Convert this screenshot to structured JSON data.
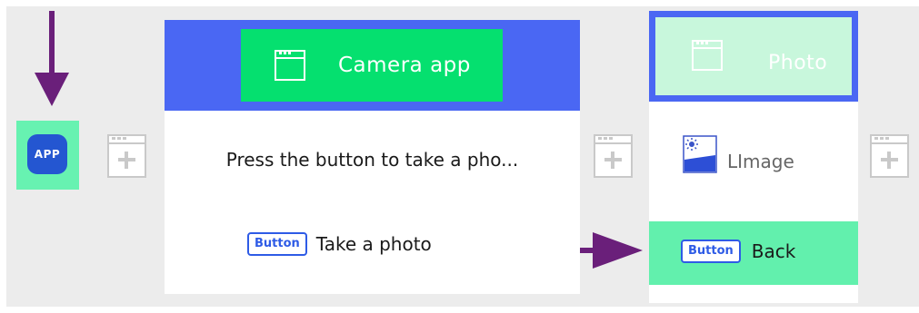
{
  "app_icon": {
    "label": "APP"
  },
  "screen1": {
    "title": "Camera app",
    "text": "Press the button to take a pho...",
    "button": {
      "chip": "Button",
      "label": "Take a photo"
    }
  },
  "screen2": {
    "title": "Photo",
    "image": {
      "label": "LImage"
    },
    "button": {
      "chip": "Button",
      "label": "Back"
    }
  },
  "colors": {
    "header_blue": "#4a67f3",
    "title_green": "#05e06f",
    "highlight_mint": "#67f2b1",
    "arrow_purple": "#6a1f7a",
    "button_blue": "#2e5be6"
  }
}
